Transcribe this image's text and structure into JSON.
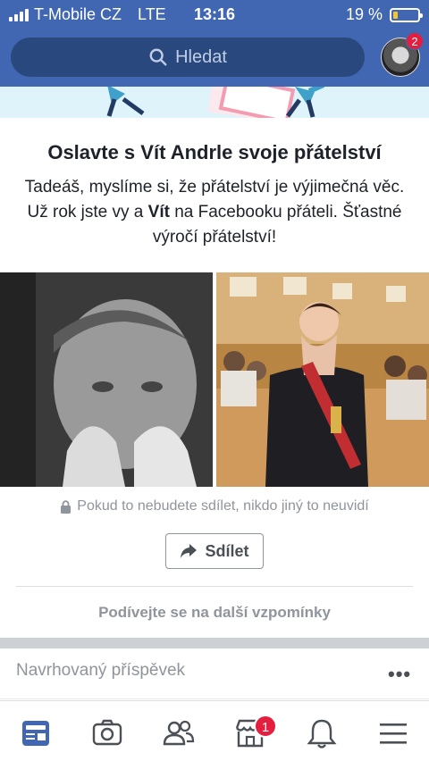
{
  "status_bar": {
    "carrier": "T-Mobile CZ",
    "network": "LTE",
    "time": "13:16",
    "battery_percent": "19 %",
    "battery_level": 0.19
  },
  "header": {
    "search_placeholder": "Hledat",
    "search_icon": "search-icon",
    "profile_badge_count": "2"
  },
  "card": {
    "title": "Oslavte s Vít Andrle svoje přátelství",
    "body_part1": "Tadeáš, myslíme si, že přátelství je výjimečná věc. Už rok jste vy a ",
    "body_bold": "Vít",
    "body_part2": " na Facebooku přáteli. Šťastné výročí přátelství!",
    "privacy_note": "Pokud to nebudete sdílet, nikdo jiný to neuvidí",
    "share_label": "Sdílet",
    "more_memories": "Podívejte se na další vzpomínky"
  },
  "suggested": {
    "label": "Navrhovaný příspěvek",
    "menu": "•••"
  },
  "tabbar": {
    "items": [
      "news-feed-icon",
      "camera-icon",
      "friends-icon",
      "marketplace-icon",
      "notifications-icon",
      "menu-icon"
    ],
    "marketplace_badge": "1"
  },
  "colors": {
    "brand": "#4267b2",
    "search_bg": "#29487d",
    "badge": "#e41e3f",
    "muted_text": "#90949c",
    "active_tab": "#4267b2"
  }
}
